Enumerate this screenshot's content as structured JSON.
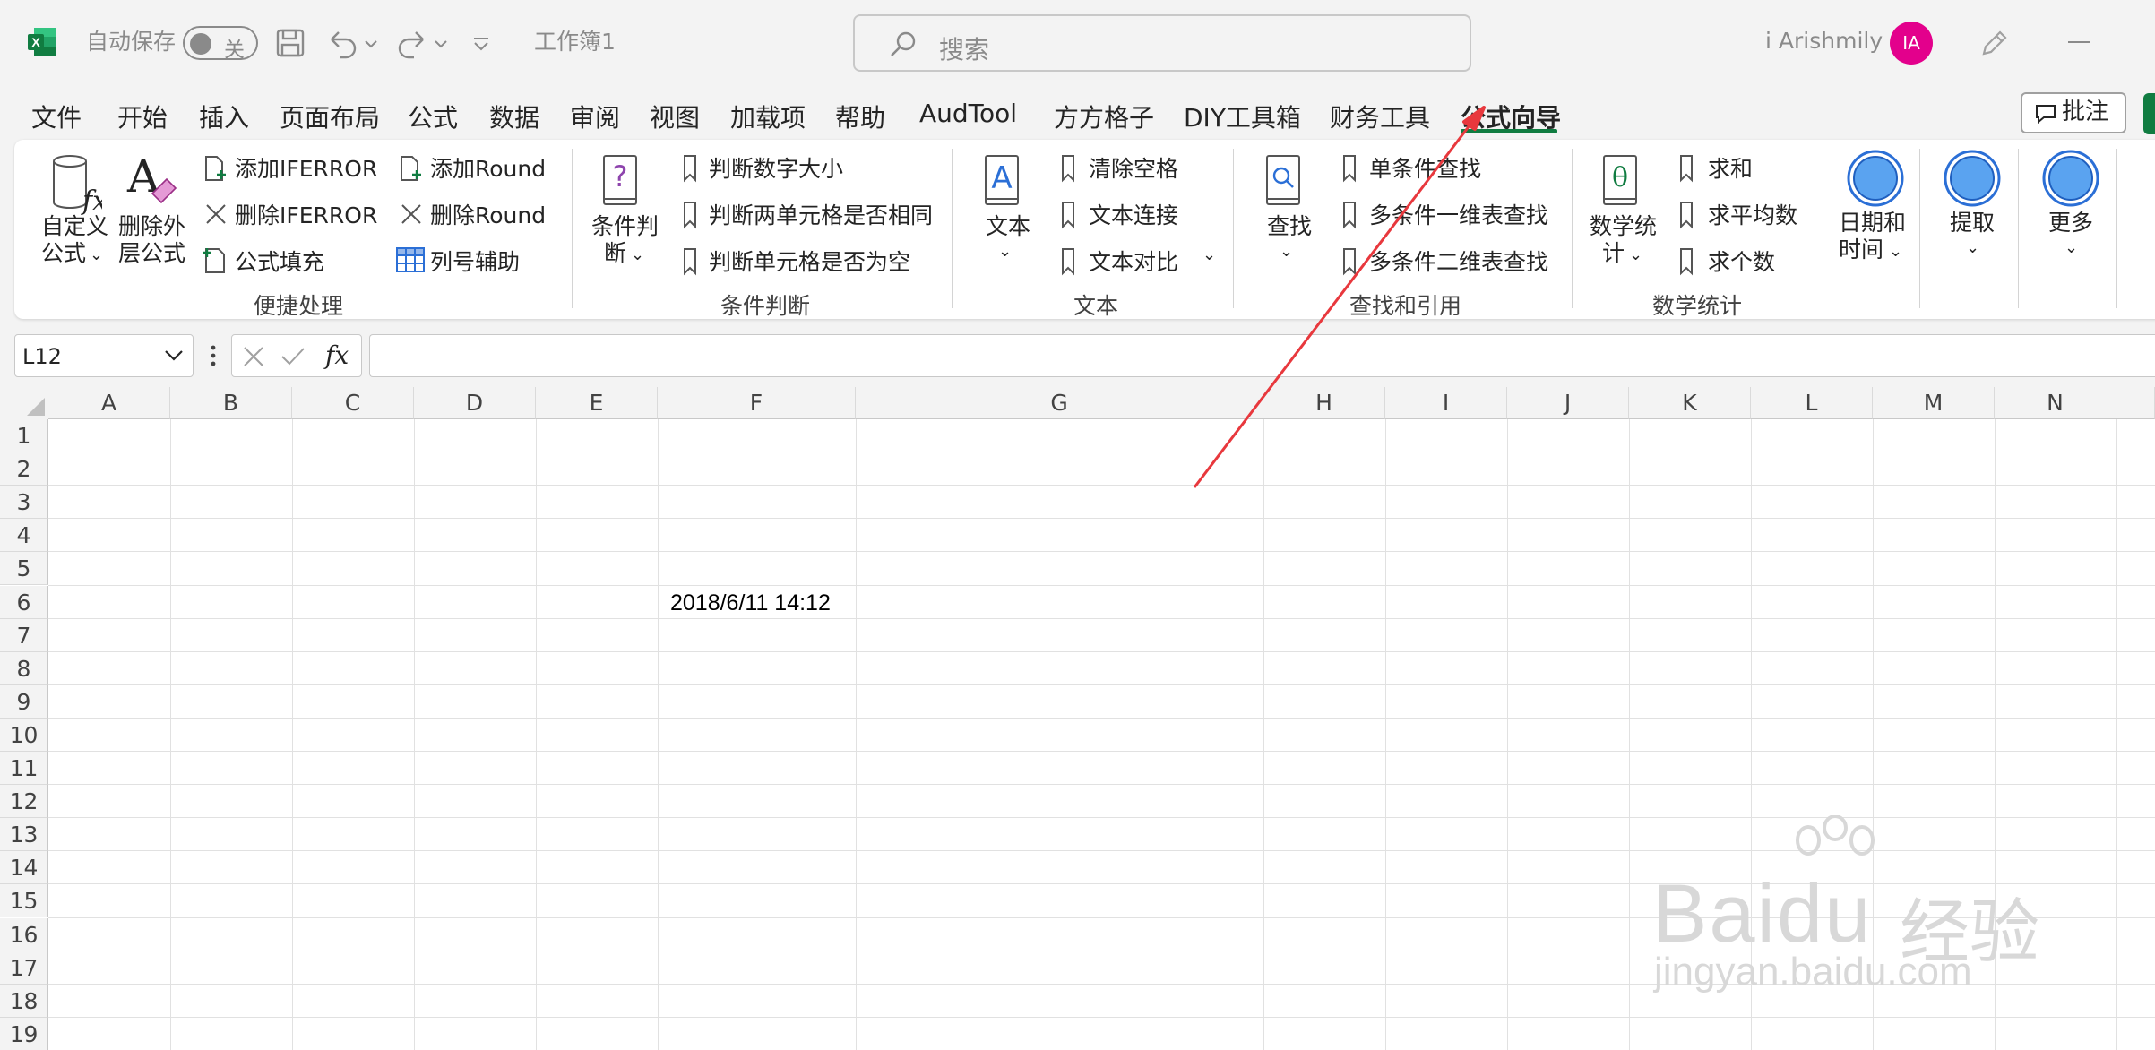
{
  "titlebar": {
    "autosave_label": "自动保存",
    "autosave_state": "关",
    "workbook_name": "工作簿1",
    "search_placeholder": "搜索",
    "user_name": "i Arishmily",
    "avatar_initials": "IA",
    "avatar_color": "#e3008c",
    "excel_brand_color": "#107c41"
  },
  "tabs": [
    "文件",
    "开始",
    "插入",
    "页面布局",
    "公式",
    "数据",
    "审阅",
    "视图",
    "加载项",
    "帮助",
    "AudTool",
    "方方格子",
    "DIY工具箱",
    "财务工具",
    "公式向导"
  ],
  "active_tab": "公式向导",
  "comment_button": "批注",
  "ribbon": {
    "quick": {
      "custom_formula_l1": "自定义",
      "custom_formula_l2": "公式",
      "delete_outer_l1": "删除外",
      "delete_outer_l2": "层公式",
      "add_iferror": "添加IFERROR",
      "del_iferror": "删除IFERROR",
      "formula_fill": "公式填充",
      "add_round": "添加Round",
      "del_round": "删除Round",
      "col_helper": "列号辅助",
      "label": "便捷处理"
    },
    "cond": {
      "big_l1": "条件判",
      "big_l2": "断",
      "items": [
        "判断数字大小",
        "判断两单元格是否相同",
        "判断单元格是否为空"
      ],
      "label": "条件判断"
    },
    "text": {
      "big": "文本",
      "items": [
        "清除空格",
        "文本连接",
        "文本对比"
      ],
      "label": "文本"
    },
    "lookup": {
      "big": "查找",
      "items": [
        "单条件查找",
        "多条件一维表查找",
        "多条件二维表查找"
      ],
      "label": "查找和引用"
    },
    "math": {
      "big_l1": "数学统",
      "big_l2": "计",
      "items": [
        "求和",
        "求平均数",
        "求个数"
      ],
      "label": "数学统计"
    },
    "datetime_l1": "日期和",
    "datetime_l2": "时间",
    "extract": "提取",
    "more": "更多"
  },
  "formula_bar": {
    "name_box": "L12",
    "fx_symbol": "fx",
    "formula": ""
  },
  "columns": [
    "A",
    "B",
    "C",
    "D",
    "E",
    "F",
    "G",
    "H",
    "I",
    "J",
    "K",
    "L",
    "M",
    "N"
  ],
  "rows": [
    "1",
    "2",
    "3",
    "4",
    "5",
    "6",
    "7",
    "8",
    "9",
    "10",
    "11",
    "12",
    "13",
    "14",
    "15",
    "16",
    "17",
    "18",
    "19"
  ],
  "cells": {
    "F6": "2018/6/11 14:12"
  },
  "annotation_color": "#e8383d",
  "watermark": {
    "brand": "Bai",
    "brand2": "du",
    "cn": "经验",
    "url": "jingyan.baidu.com"
  }
}
